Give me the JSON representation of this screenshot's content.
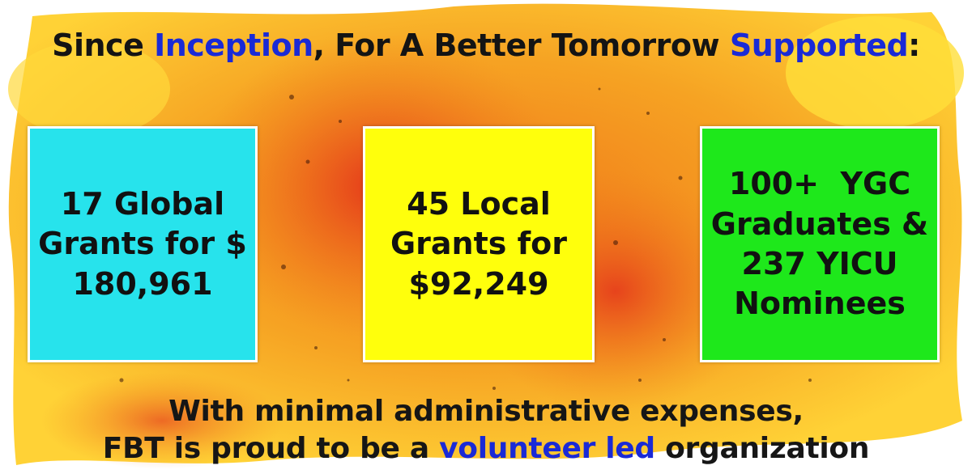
{
  "headline": {
    "part1": "Since ",
    "part2": "Inception",
    "part3": ", For A Better Tomorrow ",
    "part4": "Supported",
    "part5": ":"
  },
  "cards": [
    {
      "lines": [
        "17 Global",
        "Grants for $",
        "180,961"
      ],
      "color": "#27e3ec"
    },
    {
      "lines": [
        "45 Local",
        "Grants for",
        "$92,249"
      ],
      "color": "#ffff0c"
    },
    {
      "lines": [
        "100+  YGC",
        "Graduates &",
        "237 YICU",
        "Nominees"
      ],
      "color": "#1ee81b"
    }
  ],
  "footer": {
    "line1": "With minimal administrative expenses,",
    "line2_a": "FBT is proud to be a ",
    "line2_b": "volunteer led",
    "line2_c": " organization"
  },
  "colors": {
    "accent_text": "#1a2ad6",
    "paint_orange": "#f5a020",
    "paint_red": "#e8421a",
    "paint_yellow": "#ffd21e"
  }
}
